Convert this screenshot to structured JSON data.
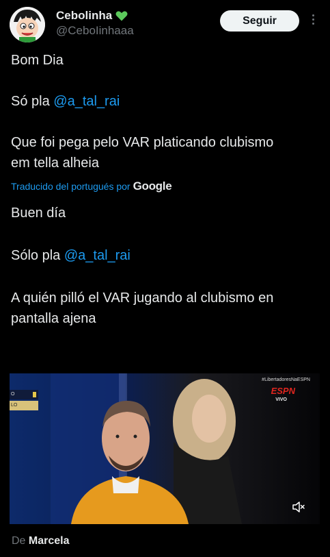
{
  "author": {
    "display_name": "Cebolinha",
    "verified_emoji": "💚",
    "handle": "@CeboIinhaaa",
    "avatar": "avatar-cartoon-icon"
  },
  "follow_button": {
    "label": "Seguir"
  },
  "original_text": {
    "line1": "Bom Dia",
    "line2_prefix": "Só pla ",
    "line2_mention": "@a_tal_rai",
    "line3": "Que foi pega pelo VAR platicando clubismo",
    "line4": "em tella alheia"
  },
  "translation": {
    "label": "Traducido del portugués por",
    "provider": "Google",
    "line1": "Buen día",
    "line2_prefix": "Sólo pla ",
    "line2_mention": "@a_tal_rai",
    "line3": "A quién pilló el VAR jugando al clubismo en",
    "line4": "pantalla ajena"
  },
  "media": {
    "hashtag": "#LibertadoresNaESPN",
    "network": "ESPN",
    "live_label": "VIVO",
    "scoreboard_line1": "O",
    "scoreboard_line2": "LO",
    "mute_icon": "muted-speaker-icon"
  },
  "attribution": {
    "prefix": "De",
    "name": "Marcela"
  },
  "colors": {
    "background": "#000000",
    "text": "#e7e9ea",
    "secondary": "#71767b",
    "link": "#1d9bf0",
    "button_bg": "#eff3f4"
  }
}
